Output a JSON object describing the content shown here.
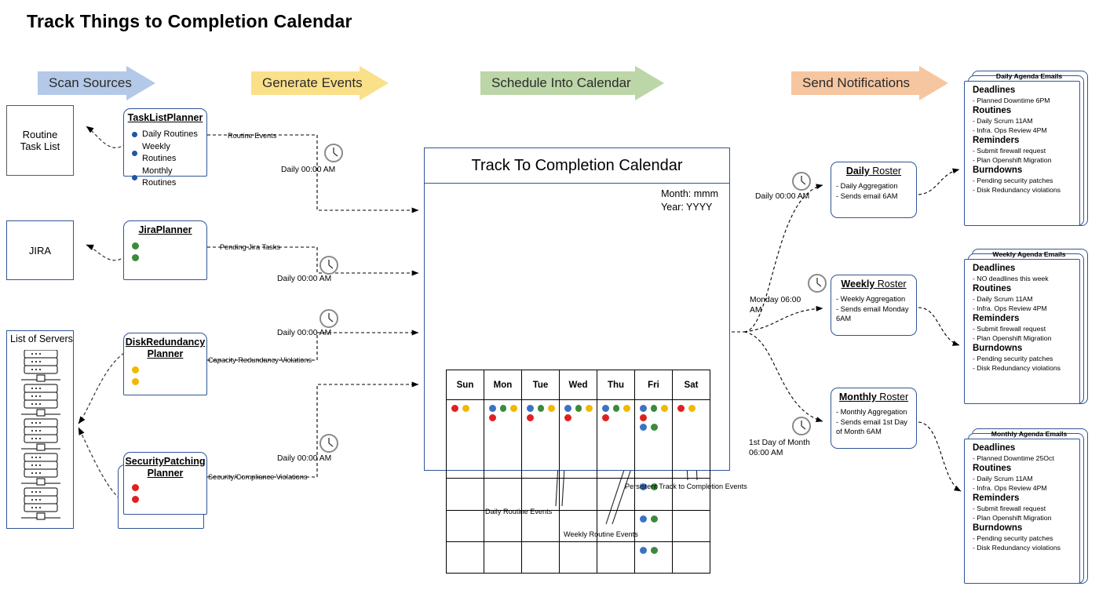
{
  "page": {
    "title": "Track Things to Completion Calendar"
  },
  "banners": [
    {
      "label": "Scan Sources",
      "color": "#b4c9e7"
    },
    {
      "label": "Generate Events",
      "color": "#fbe08a"
    },
    {
      "label": "Schedule Into Calendar",
      "color": "#bcd6a7"
    },
    {
      "label": "Send Notifications",
      "color": "#f6c6a0"
    }
  ],
  "sources": [
    {
      "name": "Routine Task List",
      "lines": [
        "Routine",
        "Task List"
      ]
    },
    {
      "name": "JIRA",
      "lines": [
        "JIRA"
      ]
    },
    {
      "name": "List of Servers",
      "lines": [
        "List of Servers"
      ]
    }
  ],
  "planners": [
    {
      "title": "TaskListPlanner",
      "title_lines": [
        "TaskListPlanner"
      ],
      "bullets": [
        {
          "label": "Daily Routines",
          "color": "#1f56a5"
        },
        {
          "label": "Weekly Routines",
          "color": "#1f56a5"
        },
        {
          "label": "Monthly Routines",
          "color": "#1f56a5"
        }
      ],
      "edge_label": "Routine Events",
      "clock_label": "Daily 00:00 AM"
    },
    {
      "title": "JiraPlanner",
      "title_lines": [
        "JiraPlanner"
      ],
      "bullets": [
        {
          "label": "",
          "color": "#3c8a3c"
        },
        {
          "label": "",
          "color": "#3c8a3c"
        }
      ],
      "edge_label": "Pending Jira Tasks",
      "clock_label": "Daily 00:00 AM"
    },
    {
      "title": "DiskRedundancy Planner",
      "title_lines": [
        "DiskRedundancy",
        "Planner"
      ],
      "bullets": [
        {
          "label": "",
          "color": "#f2b800"
        },
        {
          "label": "",
          "color": "#f2b800"
        }
      ],
      "edge_label": "Capacity Redundancy Violations",
      "clock_label": "Daily 00:00 AM"
    },
    {
      "title": "SecurityPatching Planner",
      "title_lines": [
        "SecurityPatching",
        "Planner"
      ],
      "bullets": [
        {
          "label": "",
          "color": "#e02020"
        },
        {
          "label": "",
          "color": "#e02020"
        }
      ],
      "edge_label": "Security/Compliance Violations",
      "clock_label": "Daily 00:00 AM"
    }
  ],
  "calendar": {
    "title": "Track To Completion Calendar",
    "month_label": "Month: mmm",
    "year_label": "Year: YYYY",
    "weekdays": [
      "Sun",
      "Mon",
      "Tue",
      "Wed",
      "Thu",
      "Fri",
      "Sat"
    ],
    "colors": {
      "blue": "#3b73c4",
      "green": "#3c8a3c",
      "yellow": "#f2b800",
      "red": "#e02020"
    },
    "weeks": [
      [
        [
          [
            "red",
            "yellow"
          ]
        ],
        [
          [
            "blue",
            "green",
            "yellow"
          ],
          [
            "red"
          ]
        ],
        [
          [
            "blue",
            "green",
            "yellow"
          ],
          [
            "red"
          ]
        ],
        [
          [
            "blue",
            "green",
            "yellow"
          ],
          [
            "red"
          ]
        ],
        [
          [
            "blue",
            "green",
            "yellow"
          ],
          [
            "red"
          ]
        ],
        [
          [
            "blue",
            "green",
            "yellow"
          ],
          [
            "red"
          ],
          [
            "blue",
            "green"
          ]
        ],
        [
          [
            "red",
            "yellow"
          ]
        ]
      ],
      [
        [],
        [],
        [],
        [],
        [],
        [
          [
            "blue",
            "green"
          ]
        ],
        []
      ],
      [
        [],
        [],
        [],
        [],
        [],
        [
          [
            "blue",
            "green"
          ]
        ],
        []
      ],
      [
        [],
        [],
        [],
        [],
        [],
        [
          [
            "blue",
            "green"
          ]
        ],
        []
      ]
    ]
  },
  "annotations": [
    {
      "label": "Daily Routine Events"
    },
    {
      "label": "Weekly Routine Events"
    },
    {
      "label": "Persistent Track to Completion Events"
    }
  ],
  "rosters": [
    {
      "title_bold": "Daily",
      "title_rest": " Roster",
      "body": [
        "- Daily Aggregation",
        "- Sends email 6AM"
      ],
      "clock_label": "Daily 00:00 AM",
      "clock_label_2": ""
    },
    {
      "title_bold": "Weekly",
      "title_rest": " Roster",
      "body": [
        "- Weekly Aggregation",
        "- Sends email Monday",
        "6AM"
      ],
      "clock_label": "Monday 06:00",
      "clock_label_2": "AM"
    },
    {
      "title_bold": "Monthly",
      "title_rest": " Roster",
      "body": [
        "- Monthly Aggregation",
        "- Sends email 1st Day",
        "of Month 6AM"
      ],
      "clock_label": "1st Day of Month",
      "clock_label_2": "06:00 AM"
    }
  ],
  "agendas": [
    {
      "caption": "Daily Agenda Emails",
      "sections": [
        {
          "head": "Deadlines",
          "items": [
            "- Planned Downtime 6PM"
          ]
        },
        {
          "head": "Routines",
          "items": [
            "- Daily Scrum 11AM",
            "- Infra. Ops Review 4PM"
          ]
        },
        {
          "head": "Reminders",
          "items": [
            "- Submit firewall request",
            "- Plan Openshift Migration"
          ]
        },
        {
          "head": "Burndowns",
          "items": [
            "- Pending security patches",
            "- Disk Redundancy violations"
          ]
        }
      ]
    },
    {
      "caption": "Weekly Agenda Emails",
      "sections": [
        {
          "head": "Deadlines",
          "items": [
            "- NO deadlines this week"
          ]
        },
        {
          "head": "Routines",
          "items": [
            "- Daily Scrum 11AM",
            "- Infra. Ops Review 4PM"
          ]
        },
        {
          "head": "Reminders",
          "items": [
            "- Submit firewall request",
            "- Plan Openshift Migration"
          ]
        },
        {
          "head": "Burndowns",
          "items": [
            "- Pending security patches",
            "- Disk Redundancy violations"
          ]
        }
      ]
    },
    {
      "caption": "Monthly Agenda Emails",
      "sections": [
        {
          "head": "Deadlines",
          "items": [
            "- Planned Downtime 25Oct"
          ]
        },
        {
          "head": "Routines",
          "items": [
            "- Daily Scrum 11AM",
            "- Infra. Ops Review 4PM"
          ]
        },
        {
          "head": "Reminders",
          "items": [
            "- Submit firewall request",
            "- Plan Openshift Migration"
          ]
        },
        {
          "head": "Burndowns",
          "items": [
            "- Pending security patches",
            "- Disk Redundancy violations"
          ]
        }
      ]
    }
  ]
}
